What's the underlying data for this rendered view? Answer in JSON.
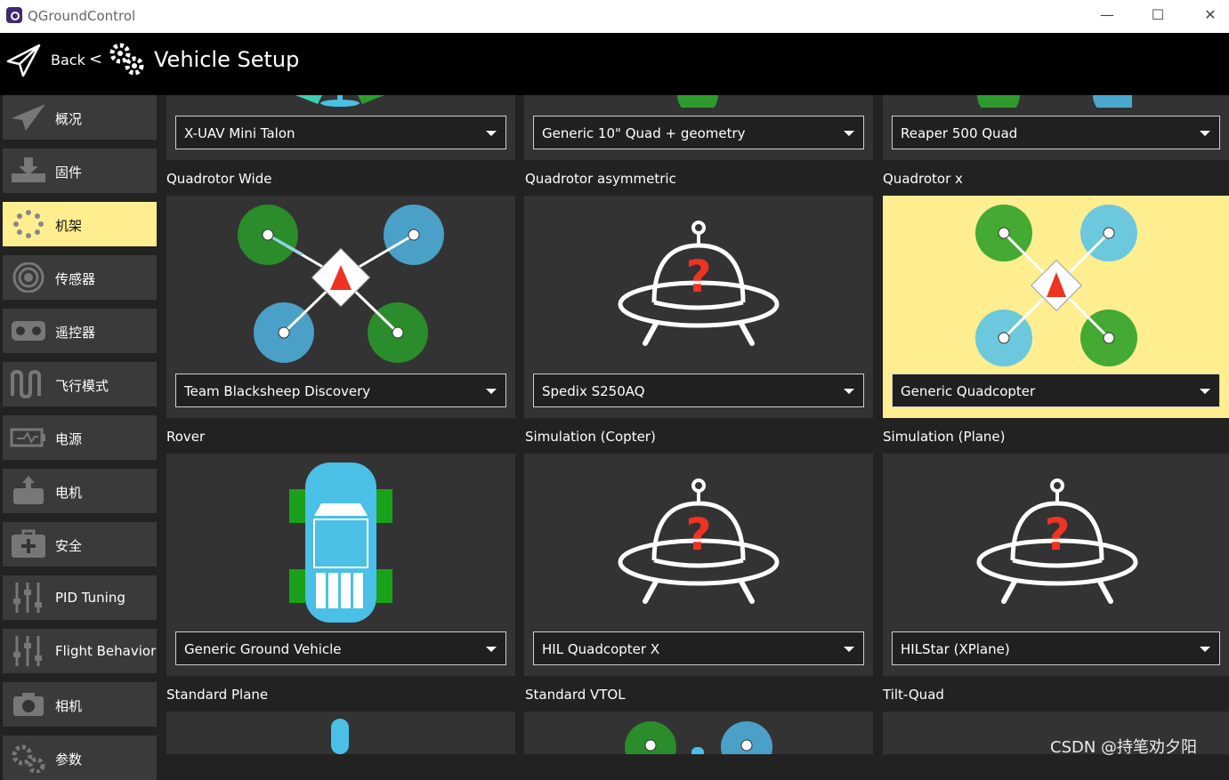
{
  "window": {
    "title": "QGroundControl",
    "minimize": "—",
    "maximize": "☐",
    "close": "✕"
  },
  "header": {
    "back_label": "Back",
    "separator": "<",
    "title": "Vehicle Setup"
  },
  "sidebar": {
    "items": [
      {
        "label": "概况",
        "icon": "plane-icon"
      },
      {
        "label": "固件",
        "icon": "download-icon"
      },
      {
        "label": "机架",
        "icon": "airframe-icon",
        "active": true
      },
      {
        "label": "传感器",
        "icon": "sensor-icon"
      },
      {
        "label": "遥控器",
        "icon": "radio-icon"
      },
      {
        "label": "飞行模式",
        "icon": "flight-modes-icon"
      },
      {
        "label": "电源",
        "icon": "power-icon"
      },
      {
        "label": "电机",
        "icon": "motor-icon"
      },
      {
        "label": "安全",
        "icon": "safety-icon"
      },
      {
        "label": "PID Tuning",
        "icon": "tuning-icon"
      },
      {
        "label": "Flight Behavior",
        "icon": "tuning-icon"
      },
      {
        "label": "相机",
        "icon": "camera-icon"
      },
      {
        "label": "参数",
        "icon": "gears-icon"
      }
    ]
  },
  "rows": [
    {
      "cards": [
        {
          "category": "",
          "selected": "X-UAV Mini Talon"
        },
        {
          "category": "",
          "selected": "Generic 10\" Quad + geometry"
        },
        {
          "category": "",
          "selected": "Reaper 500 Quad"
        }
      ]
    },
    {
      "cards": [
        {
          "category": "Quadrotor Wide",
          "selected": "Team Blacksheep Discovery"
        },
        {
          "category": "Quadrotor asymmetric",
          "selected": "Spedix S250AQ"
        },
        {
          "category": "Quadrotor x",
          "selected": "Generic Quadcopter",
          "highlighted": true
        }
      ]
    },
    {
      "cards": [
        {
          "category": "Rover",
          "selected": "Generic Ground Vehicle"
        },
        {
          "category": "Simulation (Copter)",
          "selected": "HIL Quadcopter X"
        },
        {
          "category": "Simulation (Plane)",
          "selected": "HILStar (XPlane)"
        }
      ]
    },
    {
      "cards": [
        {
          "category": "Standard Plane"
        },
        {
          "category": "Standard VTOL"
        },
        {
          "category": "Tilt-Quad"
        }
      ]
    }
  ],
  "colors": {
    "accent": "#ffee90",
    "card": "#333333",
    "green_rotor": "#2e9a2e",
    "blue_rotor": "#4aa8cc",
    "question_red": "#ee3322"
  },
  "watermark": "CSDN @持笔劝夕阳"
}
